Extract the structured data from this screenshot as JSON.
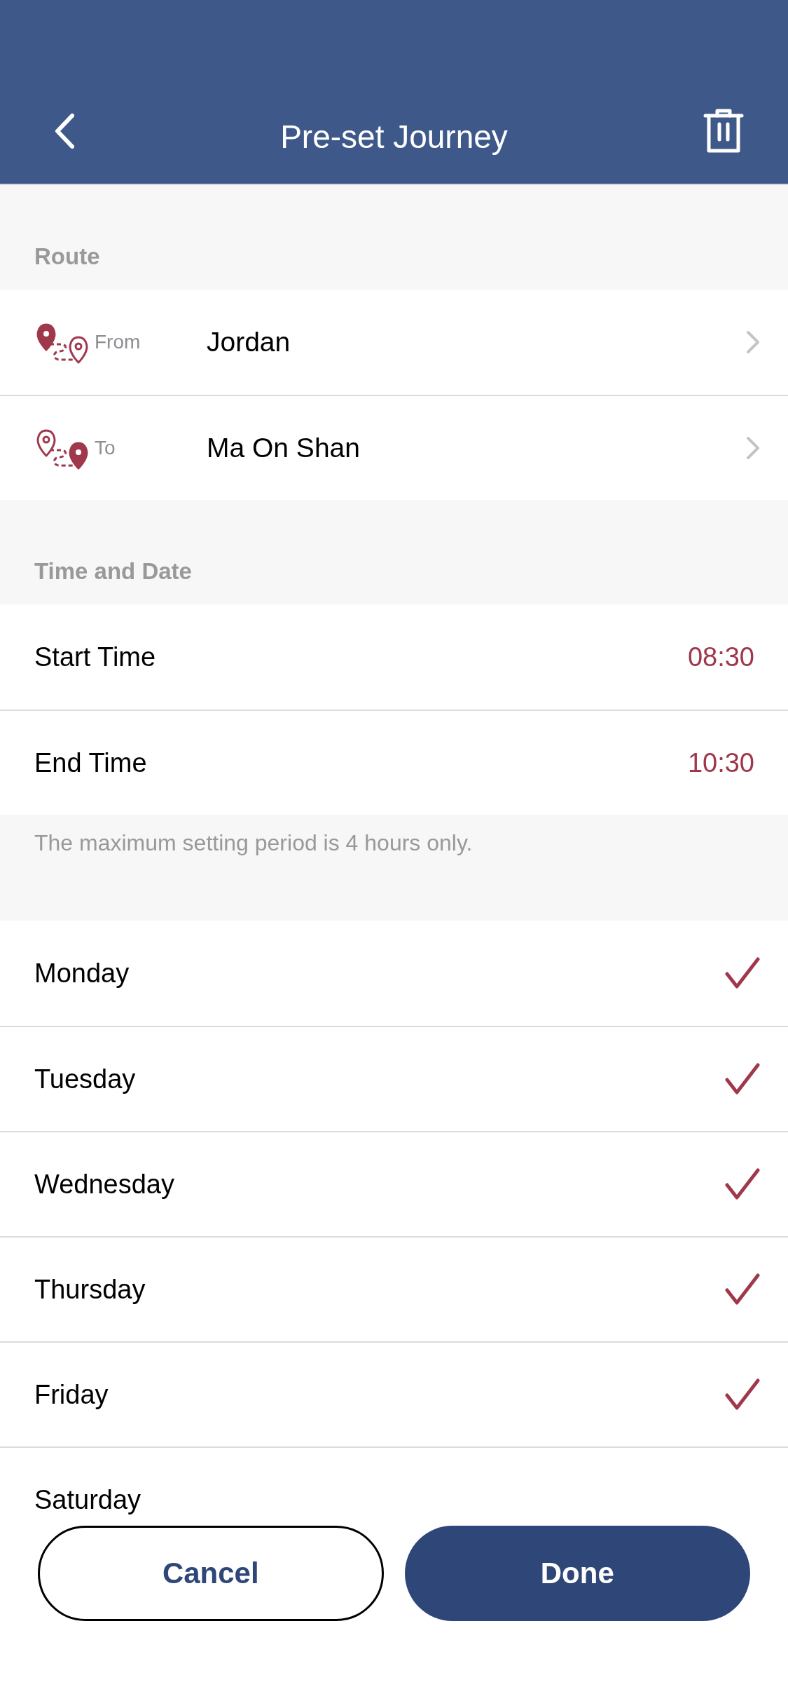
{
  "header": {
    "title": "Pre-set Journey"
  },
  "route": {
    "heading": "Route",
    "rows": [
      {
        "kind": "from",
        "label": "From",
        "value": "Jordan"
      },
      {
        "kind": "to",
        "label": "To",
        "value": "Ma On Shan"
      }
    ]
  },
  "time": {
    "heading": "Time and Date",
    "rows": [
      {
        "label": "Start Time",
        "value": "08:30"
      },
      {
        "label": "End Time",
        "value": "10:30"
      }
    ],
    "note": "The maximum setting period is 4 hours only."
  },
  "days": [
    {
      "label": "Monday",
      "checked": true
    },
    {
      "label": "Tuesday",
      "checked": true
    },
    {
      "label": "Wednesday",
      "checked": true
    },
    {
      "label": "Thursday",
      "checked": true
    },
    {
      "label": "Friday",
      "checked": true
    },
    {
      "label": "Saturday",
      "checked": false
    }
  ],
  "buttons": [
    {
      "kind": "secondary",
      "label": "Cancel"
    },
    {
      "kind": "primary",
      "label": "Done"
    }
  ]
}
